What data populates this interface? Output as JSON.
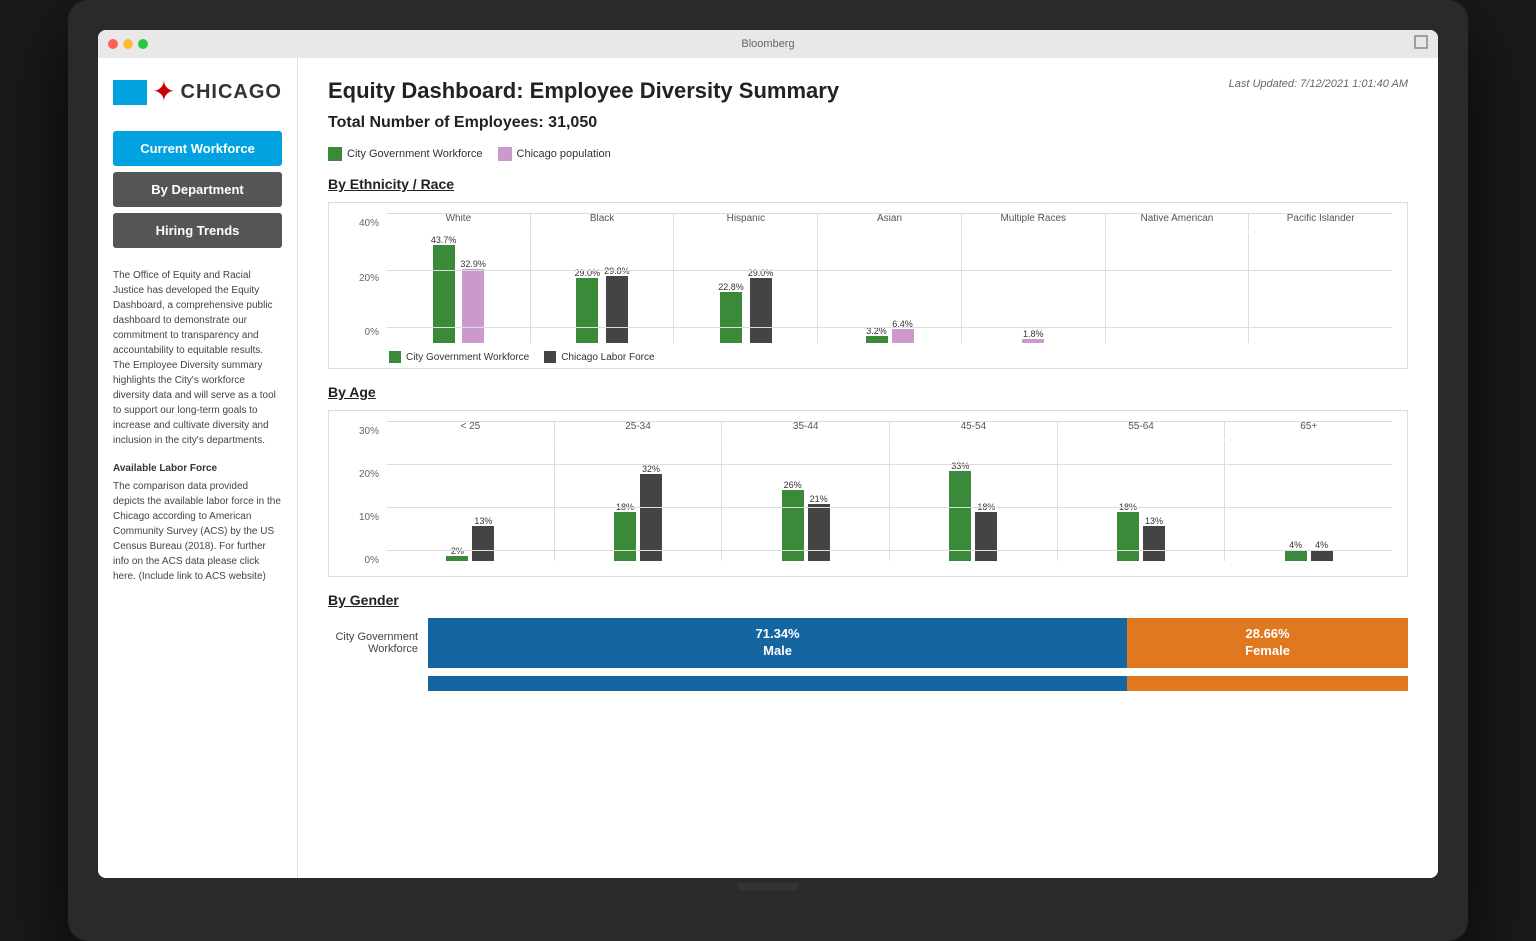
{
  "window": {
    "title": "Bloomberg"
  },
  "header": {
    "page_title": "Equity Dashboard: Employee Diversity Summary",
    "last_updated": "Last Updated: 7/12/2021 1:01:40 AM",
    "total_employees": "Total Number of Employees: 31,050"
  },
  "sidebar": {
    "logo_text": "CHICAGO",
    "nav_items": [
      {
        "label": "Current Workforce",
        "active": true
      },
      {
        "label": "By Department",
        "active": false
      },
      {
        "label": "Hiring Trends",
        "active": false
      }
    ],
    "description": "The Office of Equity and Racial Justice has developed the Equity Dashboard, a comprehensive public dashboard to demonstrate our commitment to transparency and accountability to equitable results. The Employee Diversity summary highlights the City's workforce diversity data and will serve as a tool to support our long-term goals to increase and cultivate diversity and inclusion in the city's departments.",
    "data_title": "Available Labor Force",
    "data_text": "The comparison data provided depicts the available labor force in the Chicago according to American Community Survey (ACS) by the US Census Bureau (2018). For further info on the ACS data please click here. (Include link to ACS website)"
  },
  "legend_main": {
    "item1_label": "City Government Workforce",
    "item1_color": "#3a8a3a",
    "item2_label": "Chicago population",
    "item2_color": "#cc99cc"
  },
  "ethnicity_chart": {
    "section_title": "By Ethnicity / Race",
    "legend_item1": "City Government Workforce",
    "legend_color1": "#3a8a3a",
    "legend_item2": "Chicago Labor Force",
    "legend_color2": "#444",
    "y_labels": [
      "40%",
      "20%",
      "0%"
    ],
    "groups": [
      {
        "label": "White",
        "gov_pct": 43.7,
        "labor_pct": 32.9,
        "gov_label": "43.7%",
        "labor_label": "32.9%"
      },
      {
        "label": "Black",
        "gov_pct": 29.0,
        "labor_pct": 29.8,
        "gov_label": "29.0%",
        "labor_label": "29.8%"
      },
      {
        "label": "Hispanic",
        "gov_pct": 22.8,
        "labor_pct": 29.0,
        "gov_label": "22.8%",
        "labor_label": "29.0%"
      },
      {
        "label": "Asian",
        "gov_pct": 3.2,
        "labor_pct": 6.4,
        "gov_label": "3.2%",
        "labor_label": "6.4%"
      },
      {
        "label": "Multiple Races",
        "gov_pct": 1.8,
        "labor_pct": 0,
        "gov_label": "1.8%",
        "labor_label": ""
      },
      {
        "label": "Native American",
        "gov_pct": 0,
        "labor_pct": 0,
        "gov_label": "",
        "labor_label": ""
      },
      {
        "label": "Pacific Islander",
        "gov_pct": 0,
        "labor_pct": 0,
        "gov_label": "",
        "labor_label": ""
      }
    ]
  },
  "age_chart": {
    "section_title": "By Age",
    "legend_item1": "City Government Workforce",
    "legend_color1": "#3a8a3a",
    "legend_item2": "Chicago Labor Force",
    "legend_color2": "#444",
    "y_labels": [
      "30%",
      "20%",
      "10%",
      "0%"
    ],
    "groups": [
      {
        "label": "< 25",
        "gov_pct": 2,
        "labor_pct": 13,
        "gov_label": "2%",
        "labor_label": "13%"
      },
      {
        "label": "25-34",
        "gov_pct": 18,
        "labor_pct": 32,
        "gov_label": "18%",
        "labor_label": "32%"
      },
      {
        "label": "35-44",
        "gov_pct": 26,
        "labor_pct": 21,
        "gov_label": "26%",
        "labor_label": "21%"
      },
      {
        "label": "45-54",
        "gov_pct": 33,
        "labor_pct": 18,
        "gov_label": "33%",
        "labor_label": "18%"
      },
      {
        "label": "55-64",
        "gov_pct": 18,
        "labor_pct": 13,
        "gov_label": "18%",
        "labor_label": "13%"
      },
      {
        "label": "65+",
        "gov_pct": 4,
        "labor_pct": 4,
        "gov_label": "4%",
        "labor_label": "4%"
      }
    ]
  },
  "gender_chart": {
    "section_title": "By Gender",
    "row1_label": "City Government\nWorkforce",
    "male_pct": 71.34,
    "female_pct": 28.66,
    "male_label": "71.34%\nMale",
    "female_label": "28.66%\nFemale",
    "male_color": "#1565a0",
    "female_color": "#e07820"
  }
}
